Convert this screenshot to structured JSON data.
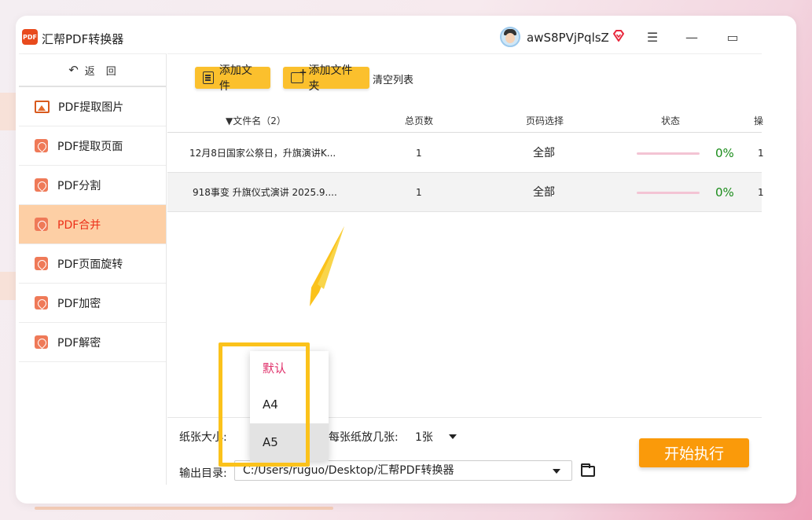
{
  "app": {
    "title": "汇帮PDF转换器",
    "logo_text": "PDF",
    "username": "awS8PVjPqlsZ"
  },
  "window_controls": {
    "menu": "☰",
    "minimize": "—",
    "maximize": "▭"
  },
  "sidebar": {
    "back_label": "返",
    "back_label2": "回",
    "items": [
      {
        "label": "PDF提取图片",
        "icon": "image-icon"
      },
      {
        "label": "PDF提取页面",
        "icon": "pdf-icon"
      },
      {
        "label": "PDF分割",
        "icon": "pdf-icon"
      },
      {
        "label": "PDF合并",
        "icon": "pdf-icon",
        "active": true
      },
      {
        "label": "PDF页面旋转",
        "icon": "pdf-icon"
      },
      {
        "label": "PDF加密",
        "icon": "pdf-icon"
      },
      {
        "label": "PDF解密",
        "icon": "pdf-icon"
      }
    ]
  },
  "toolbar": {
    "add_file": "添加文件",
    "add_folder": "添加文件夹",
    "clear_list": "清空列表"
  },
  "table": {
    "headers": [
      "▼文件名（2）",
      "总页数",
      "页码选择",
      "状态",
      "操"
    ],
    "rows": [
      {
        "name": "12月8日国家公祭日，升旗演讲K...",
        "pages": "1",
        "selection": "全部",
        "progress": 0,
        "status": "0%",
        "extra": "1"
      },
      {
        "name": "918事变 升旗仪式演讲 2025.9....",
        "pages": "1",
        "selection": "全部",
        "progress": 0,
        "status": "0%",
        "extra": "1"
      }
    ]
  },
  "bottom": {
    "paper_size_label": "纸张大小:",
    "per_sheet_label": "每张纸放几张:",
    "per_sheet_value": "1张",
    "output_label": "输出目录:",
    "output_path": "C:/Users/ruguo/Desktop/汇帮PDF转换器",
    "start_button": "开始执行"
  },
  "dropdown": {
    "options": [
      "默认",
      "A4",
      "A5"
    ],
    "highlighted": "A5"
  },
  "colors": {
    "accent_yellow": "#fbc02d",
    "start_orange": "#fa9a0a",
    "active_bg": "#fdcfa5",
    "active_text": "#ec2f18",
    "progress_green": "#1a8c1a"
  }
}
